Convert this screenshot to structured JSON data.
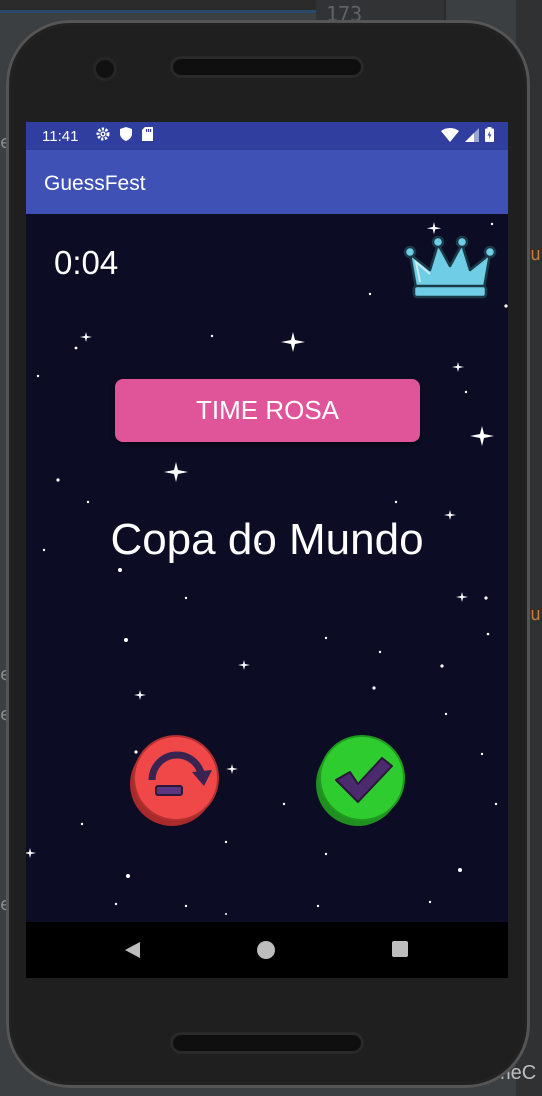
{
  "ide": {
    "line_number": "173",
    "side_chars": [
      "e",
      "e",
      "e",
      "e"
    ],
    "orange_chars": [
      "u",
      "u"
    ],
    "bottom_text": "meC"
  },
  "status_bar": {
    "time": "11:41",
    "left_icons": [
      "gear-icon",
      "shield-icon",
      "sd-card-icon"
    ],
    "right_icons": [
      "wifi-icon",
      "signal-icon",
      "battery-icon"
    ]
  },
  "app_bar": {
    "title": "GuessFest"
  },
  "game": {
    "timer": "0:04",
    "team_button_label": "TIME ROSA",
    "word": "Copa do Mundo",
    "skip_button_icon": "skip-icon",
    "correct_button_icon": "check-icon",
    "crown_icon": "crown-icon"
  },
  "colors": {
    "status_bar": "#303f9f",
    "app_bar": "#3f51b5",
    "background": "#0c0c24",
    "team_button": "#e0559a",
    "skip_button": "#f04848",
    "correct_button": "#2ecc2e",
    "crown": "#6fcde6"
  },
  "nav_bar": {
    "buttons": [
      "back-icon",
      "home-icon",
      "recents-icon"
    ]
  }
}
